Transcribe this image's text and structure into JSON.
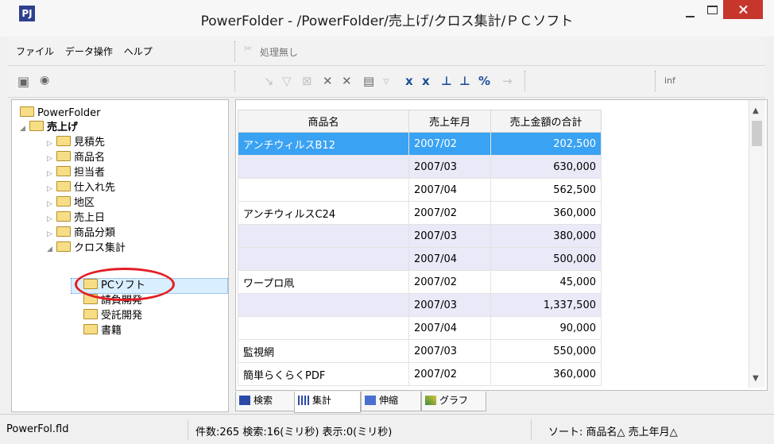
{
  "window": {
    "app_icon": "PJ",
    "title": "PowerFolder - /PowerFolder/売上げ/クロス集計/ＰＣソフト"
  },
  "menu": [
    "ファイル",
    "データ操作",
    "ヘルプ"
  ],
  "toolbar": {
    "process_status": "処理無し",
    "right_label": "inf",
    "icons": [
      "tree-view-icon",
      "eye-icon",
      "sort-icon",
      "filter-icon",
      "cross-tab-icon",
      "percent-icon",
      "arrow-right-icon"
    ]
  },
  "tree": {
    "root": "PowerFolder",
    "sales": "売上げ",
    "children": [
      "見積先",
      "商品名",
      "担当者",
      "仕入れ先",
      "地区",
      "売上日",
      "商品分類"
    ],
    "cross": "クロス集計",
    "cross_children": [
      "PCソフト",
      "請負開発",
      "受託開発",
      "書籍"
    ],
    "selected": "PCソフト"
  },
  "grid": {
    "columns": [
      "商品名",
      "売上年月",
      "売上金額の合計"
    ],
    "rows": [
      [
        "アンチウィルスB12",
        "2007/02",
        "202,500"
      ],
      [
        "",
        "2007/03",
        "630,000"
      ],
      [
        "",
        "2007/04",
        "562,500"
      ],
      [
        "アンチウィルスC24",
        "2007/02",
        "360,000"
      ],
      [
        "",
        "2007/03",
        "380,000"
      ],
      [
        "",
        "2007/04",
        "500,000"
      ],
      [
        "ワープロ凧",
        "2007/02",
        "45,000"
      ],
      [
        "",
        "2007/03",
        "1,337,500"
      ],
      [
        "",
        "2007/04",
        "90,000"
      ],
      [
        "監視網",
        "2007/03",
        "550,000"
      ],
      [
        "簡単らくらくPDF",
        "2007/02",
        "360,000"
      ]
    ]
  },
  "tabs": [
    "検索",
    "集計",
    "伸縮",
    "グラフ"
  ],
  "status": {
    "file": "PowerFol.fld",
    "counts": "件数:265 検索:16(ミリ秒) 表示:0(ミリ秒)",
    "sort": "ソート: 商品名△ 売上年月△"
  },
  "colors": {
    "selection": "#3aa2f2",
    "row_alt": "#e9e9f8",
    "close_button": "#c7362a",
    "highlight_ring": "#e31e24"
  }
}
